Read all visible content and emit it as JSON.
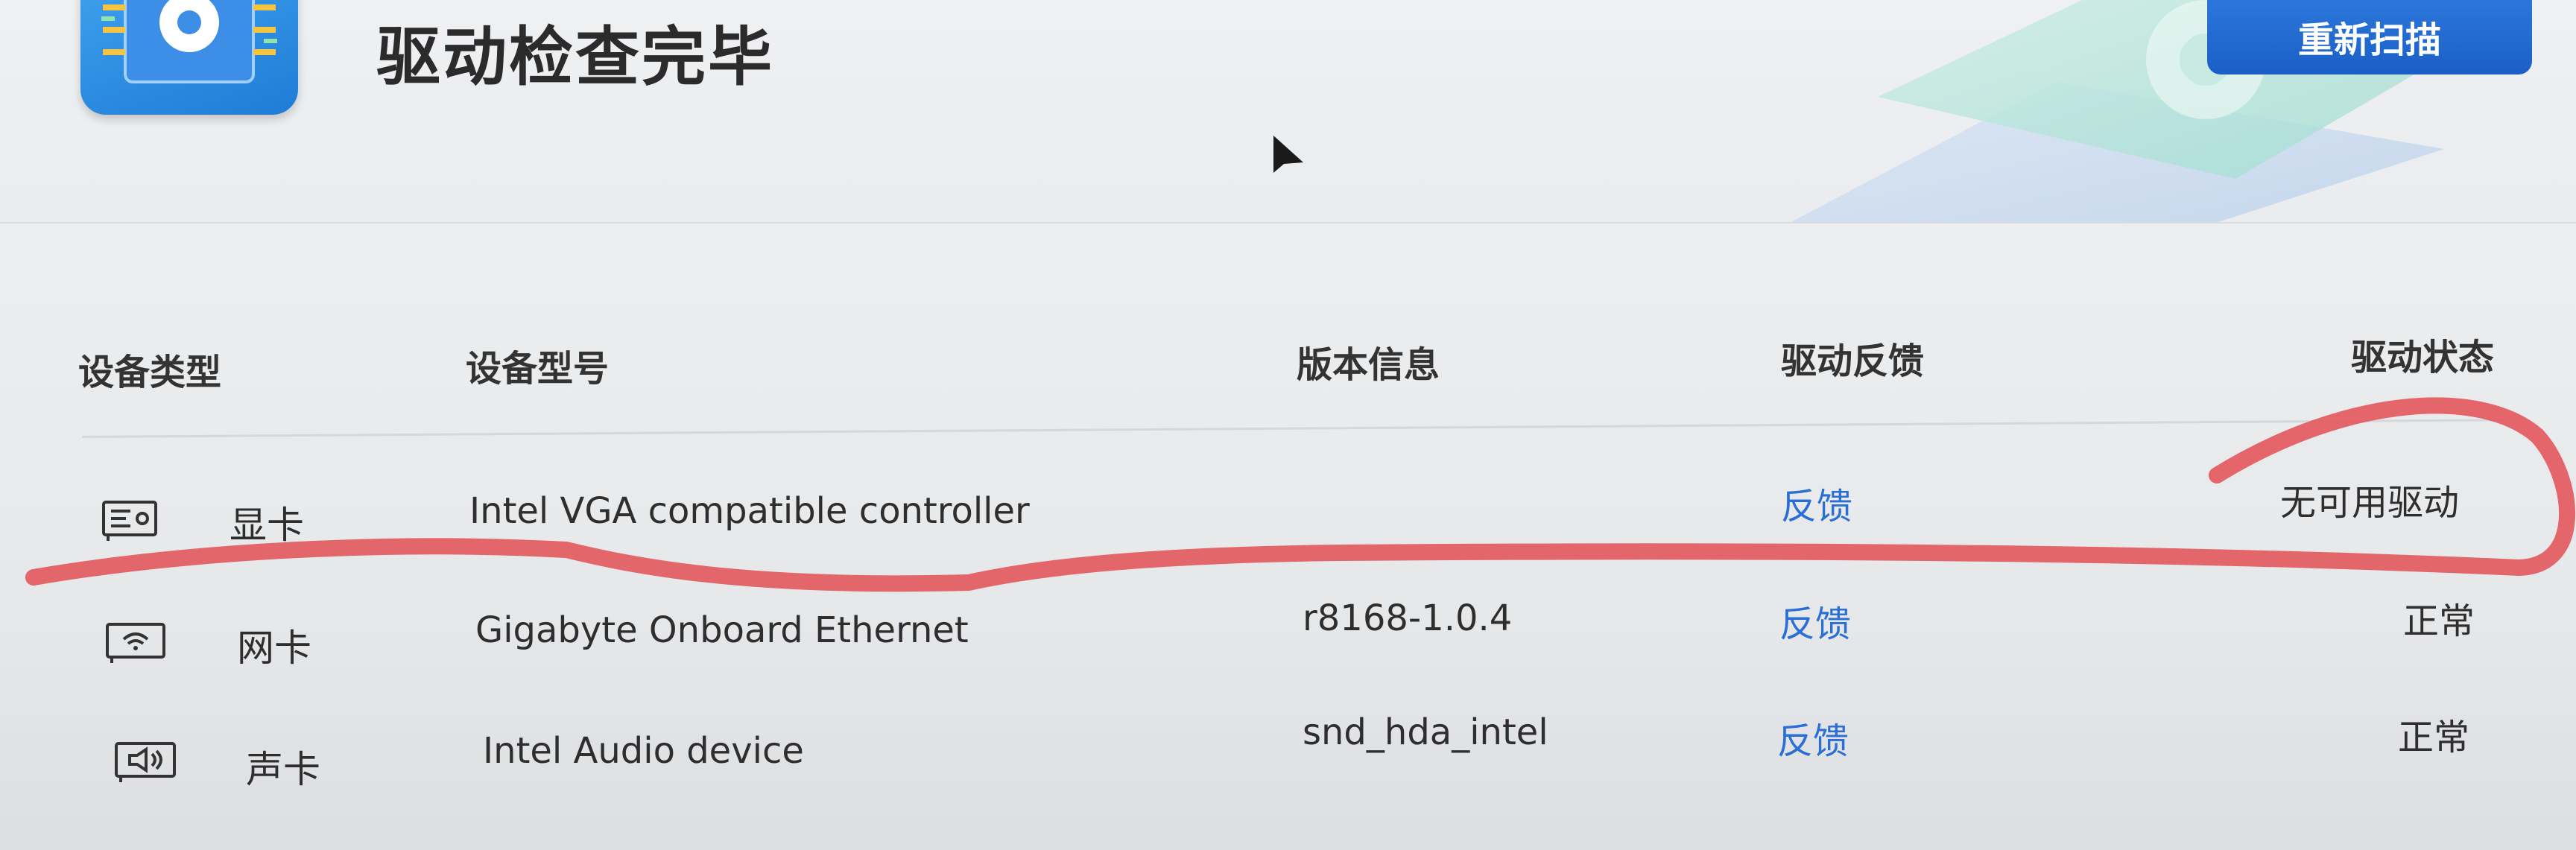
{
  "header": {
    "title": "驱动检查完毕",
    "rescan_label": "重新扫描"
  },
  "table": {
    "columns": [
      "设备类型",
      "设备型号",
      "版本信息",
      "驱动反馈",
      "驱动状态"
    ],
    "rows": [
      {
        "type": "显卡",
        "icon": "display-card-icon",
        "model": "Intel VGA compatible controller",
        "version": "",
        "feedback": "反馈",
        "status": "无可用驱动"
      },
      {
        "type": "网卡",
        "icon": "network-card-icon",
        "model": "Gigabyte Onboard Ethernet",
        "version": "r8168-1.0.4",
        "feedback": "反馈",
        "status": "正常"
      },
      {
        "type": "声卡",
        "icon": "sound-card-icon",
        "model": "Intel Audio device",
        "version": "snd_hda_intel",
        "feedback": "反馈",
        "status": "正常"
      }
    ]
  },
  "colors": {
    "accent": "#1f6bd6",
    "link": "#2a6fd6",
    "annotation": "#e35a5f"
  }
}
